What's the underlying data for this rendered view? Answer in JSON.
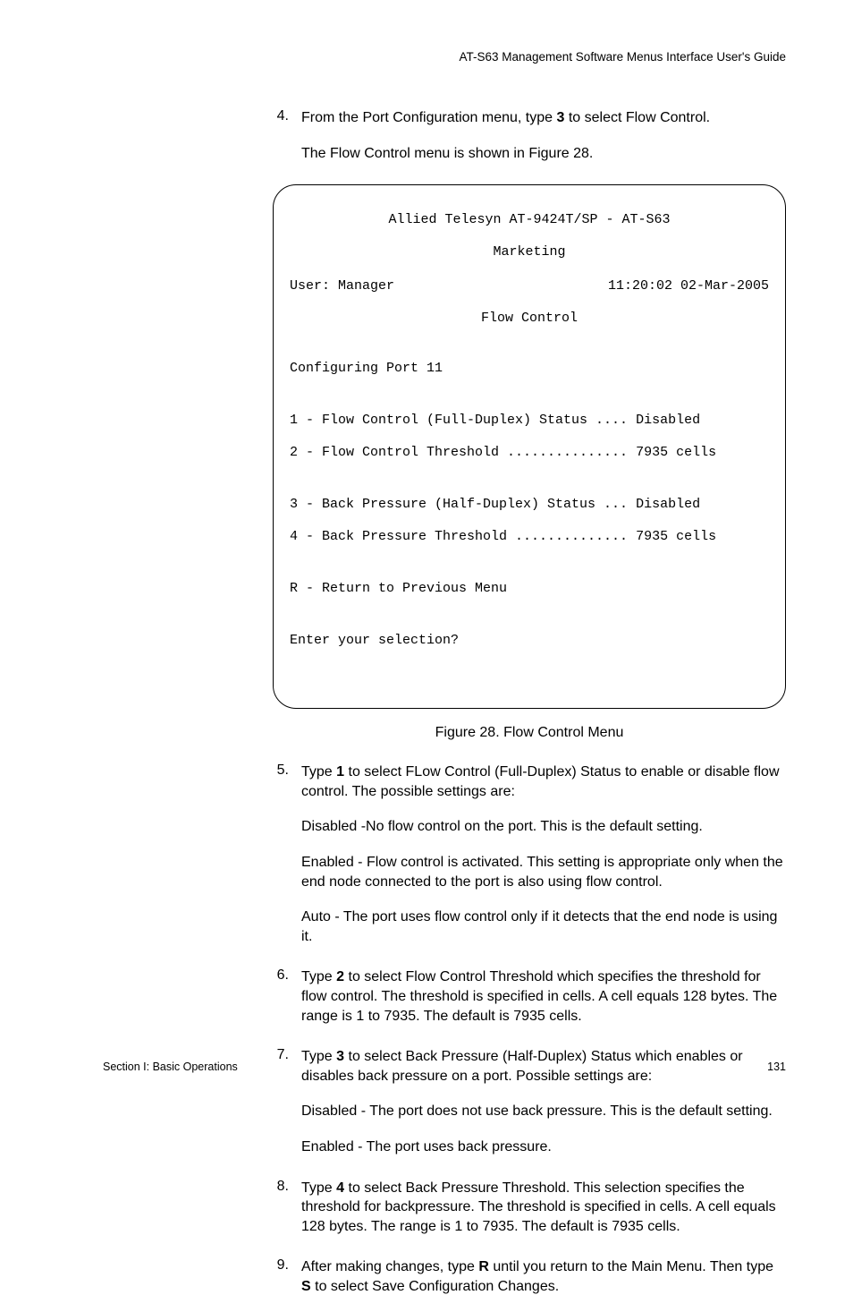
{
  "header": "AT-S63 Management Software Menus Interface User's Guide",
  "steps": {
    "s4": {
      "no": "4.",
      "line1_pre": "From the Port Configuration menu, type ",
      "line1_bold": "3",
      "line1_post": " to select Flow Control.",
      "line2": "The Flow Control menu is shown in Figure 28."
    },
    "s5": {
      "no": "5.",
      "line1_pre": "Type ",
      "line1_bold": "1",
      "line1_post": " to select FLow Control (Full-Duplex) Status to enable or disable flow control. The possible settings are:",
      "p2": "Disabled -No flow control on the port. This is the default setting.",
      "p3": "Enabled - Flow control is activated. This setting is appropriate only when the end node connected to the port is also using flow control.",
      "p4": "Auto - The port uses flow control only if it detects that the end node is using it."
    },
    "s6": {
      "no": "6.",
      "line1_pre": "Type ",
      "line1_bold": "2",
      "line1_post": " to select Flow Control Threshold which specifies the threshold for flow control. The threshold is specified in cells. A cell equals 128 bytes. The range is 1 to 7935. The default is 7935 cells."
    },
    "s7": {
      "no": "7.",
      "line1_pre": "Type ",
      "line1_bold": "3",
      "line1_post": " to select Back Pressure (Half-Duplex) Status which enables or disables back pressure on a port. Possible settings are:",
      "p2": "Disabled - The port does not use back pressure. This is the default setting.",
      "p3": "Enabled - The port uses back pressure."
    },
    "s8": {
      "no": "8.",
      "line1_pre": "Type ",
      "line1_bold": "4",
      "line1_post": " to select Back Pressure Threshold. This selection specifies the threshold for backpressure. The threshold is specified in cells. A cell equals 128 bytes. The range is 1 to 7935. The default is 7935 cells."
    },
    "s9": {
      "no": "9.",
      "line1_pre": "After making changes, type ",
      "line1_bold": "R",
      "line1_mid": " until you return to the Main Menu. Then type ",
      "line1_bold2": "S",
      "line1_post": " to select Save Configuration Changes."
    }
  },
  "menu": {
    "device": "Allied Telesyn AT-9424T/SP - AT-S63",
    "subhead": "Marketing",
    "user": "User: Manager",
    "datetime": "11:20:02 02-Mar-2005",
    "title": "Flow Control",
    "configuring": "Configuring Port 11",
    "opt1": "1 - Flow Control (Full-Duplex) Status .... Disabled",
    "opt2": "2 - Flow Control Threshold ............... 7935 cells",
    "opt3": "3 - Back Pressure (Half-Duplex) Status ... Disabled",
    "opt4": "4 - Back Pressure Threshold .............. 7935 cells",
    "return": "R - Return to Previous Menu",
    "prompt": "Enter your selection?"
  },
  "figure_caption": "Figure 28. Flow Control Menu",
  "footer": {
    "left": "Section I: Basic Operations",
    "right": "131"
  }
}
